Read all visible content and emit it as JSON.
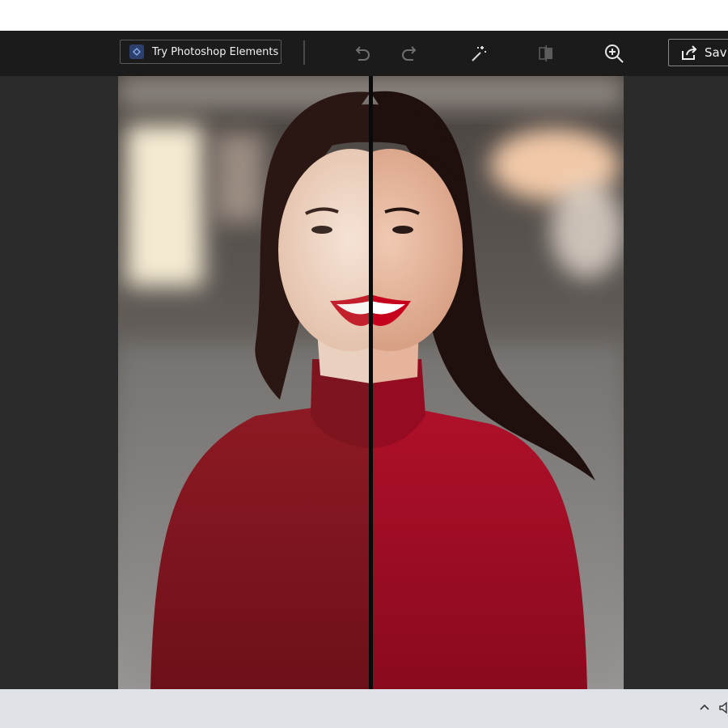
{
  "toolbar": {
    "try_label": "Try Photoshop Elements",
    "save_label": "Sav",
    "icons": [
      "photoshop-elements-logo",
      "undo-icon",
      "redo-icon",
      "enhance-wand-icon",
      "compare-icon",
      "zoom-in-icon",
      "share-save-icon"
    ]
  },
  "canvas": {
    "background": "#2b2b2b",
    "split_compare": true
  },
  "taskbar": {
    "tray_icons": [
      "chevron-up-icon",
      "speaker-icon"
    ]
  },
  "colors": {
    "toolbar_bg": "#1b1b1b",
    "canvas_bg": "#2b2b2b",
    "taskbar_bg": "#dfe3e8",
    "sweater_red": "#9e0f22"
  }
}
